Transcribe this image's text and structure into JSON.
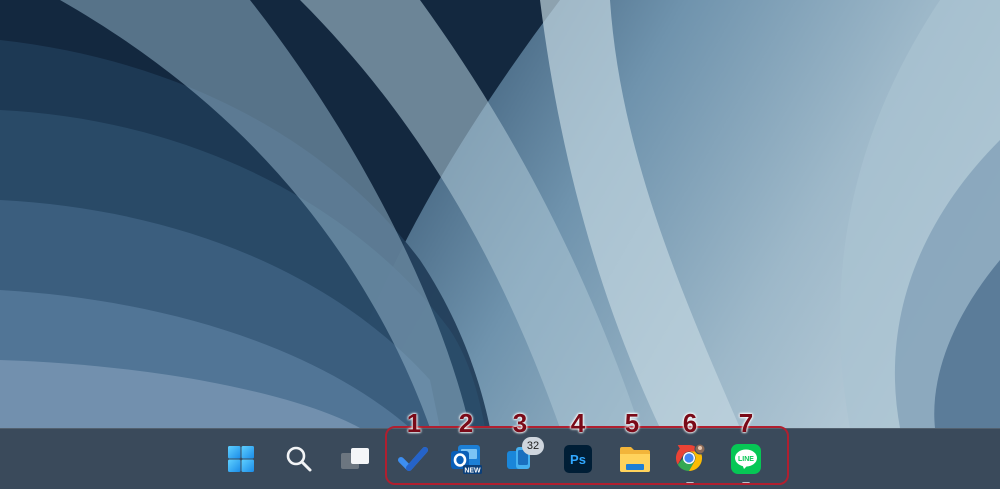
{
  "desktop": {
    "wallpaper": "bloom-blue",
    "colors": {
      "dark": "#0f2236",
      "mid": "#6f93ad",
      "light": "#c5d6e0"
    }
  },
  "taskbar": {
    "background": "#3a4a5b",
    "system_buttons": [
      {
        "name": "start-button",
        "icon": "windows-logo-icon"
      },
      {
        "name": "search-button",
        "icon": "search-icon"
      },
      {
        "name": "task-view-button",
        "icon": "task-view-icon"
      }
    ],
    "apps": [
      {
        "number": "1",
        "icon": "todo-checkmark-icon",
        "badge": "",
        "running": false
      },
      {
        "number": "2",
        "icon": "outlook-new-icon",
        "icon_label": "NEW",
        "badge": "",
        "running": false
      },
      {
        "number": "3",
        "icon": "phone-link-icon",
        "badge": "32",
        "running": false
      },
      {
        "number": "4",
        "icon": "photoshop-icon",
        "icon_label": "Ps",
        "badge": "",
        "running": false
      },
      {
        "number": "5",
        "icon": "file-explorer-icon",
        "badge": "",
        "running": false
      },
      {
        "number": "6",
        "icon": "chrome-icon",
        "badge": "",
        "running": true
      },
      {
        "number": "7",
        "icon": "line-app-icon",
        "icon_label": "LINE",
        "badge": "",
        "running": true
      }
    ]
  },
  "annotation": {
    "highlight_color": "#b01f2f",
    "number_color": "#7a0a18"
  }
}
